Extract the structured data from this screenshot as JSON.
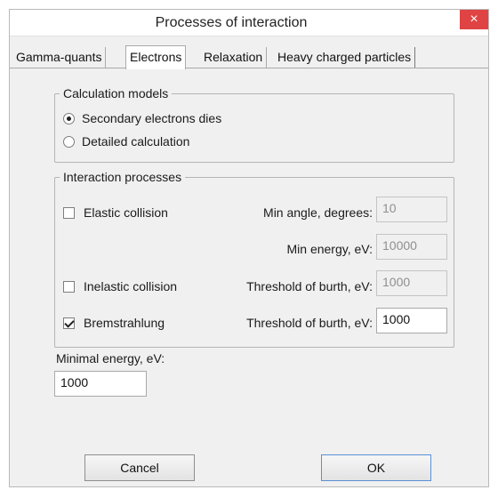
{
  "window": {
    "title": "Processes of interaction",
    "close_glyph": "×"
  },
  "tabs": [
    {
      "label": "Gamma-quants",
      "active": false
    },
    {
      "label": "Electrons",
      "active": true
    },
    {
      "label": "Relaxation",
      "active": false
    },
    {
      "label": "Heavy charged particles",
      "active": false
    }
  ],
  "calculation_models": {
    "legend": "Calculation models",
    "options": [
      {
        "label": "Secondary electrons dies",
        "selected": true
      },
      {
        "label": "Detailed calculation",
        "selected": false
      }
    ]
  },
  "interaction_processes": {
    "legend": "Interaction processes",
    "elastic": {
      "label": "Elastic collision",
      "checked": false,
      "min_angle_label": "Min angle, degrees:",
      "min_angle_value": "10",
      "min_energy_label": "Min energy, eV:",
      "min_energy_value": "10000"
    },
    "inelastic": {
      "label": "Inelastic collision",
      "checked": false,
      "threshold_label": "Threshold of burth, eV:",
      "threshold_value": "1000"
    },
    "bremsstrahlung": {
      "label": "Bremstrahlung",
      "checked": true,
      "threshold_label": "Threshold of burth, eV:",
      "threshold_value": "1000"
    }
  },
  "minimal_energy": {
    "label": "Minimal energy, eV:",
    "value": "1000"
  },
  "buttons": {
    "cancel": "Cancel",
    "ok": "OK"
  },
  "colors": {
    "close_button": "#e04343",
    "background": "#f0f0f0",
    "ok_border": "#5a8fd6"
  }
}
